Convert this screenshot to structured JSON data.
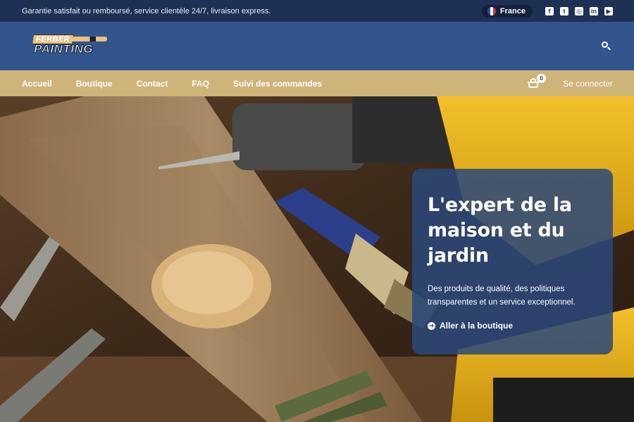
{
  "topbar": {
    "tagline": "Garantie satisfait ou remboursé, service clientèle 24/7, livraison express.",
    "language": "France",
    "social": [
      "facebook-icon",
      "twitter-icon",
      "instagram-icon",
      "linkedin-icon",
      "youtube-icon"
    ]
  },
  "header": {
    "logo_top": "FERBER",
    "logo_bottom": "PAINTING"
  },
  "nav": {
    "items": [
      "Accueil",
      "Boutique",
      "Contact",
      "FAQ",
      "Suivi des commandes"
    ],
    "cart_count": "0",
    "login": "Se connecter"
  },
  "hero": {
    "title": "L'expert de la maison et du jardin",
    "subtitle": "Des produits de qualité, des politiques transparentes et un service exceptionnel.",
    "cta": "Aller à la boutique"
  },
  "colors": {
    "topbar": "#1f3055",
    "header": "#33558e",
    "nav": "#cfb47a",
    "card": "#2b487a"
  }
}
